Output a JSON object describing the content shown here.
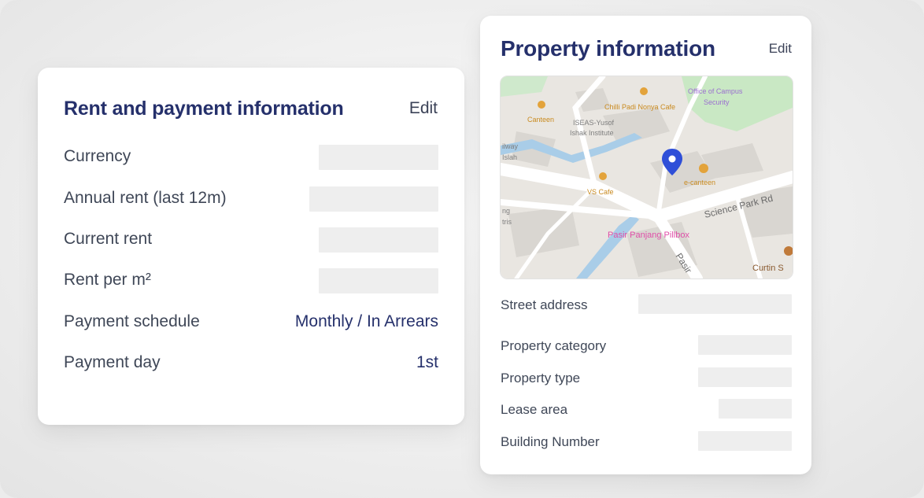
{
  "rent_card": {
    "title": "Rent and payment information",
    "edit_label": "Edit",
    "rows": [
      {
        "label": "Currency",
        "value": null
      },
      {
        "label": "Annual rent (last 12m)",
        "value": null
      },
      {
        "label": "Current rent",
        "value": null
      },
      {
        "label": "Rent per m²",
        "value": null
      },
      {
        "label": "Payment schedule",
        "value": "Monthly / In Arrears"
      },
      {
        "label": "Payment day",
        "value": "1st"
      }
    ]
  },
  "property_card": {
    "title": "Property information",
    "edit_label": "Edit",
    "map": {
      "labels": {
        "campus_security": "Office of Campus",
        "campus_security_2": "Security",
        "chilli_padi": "Chilli Padi Nonya Cafe",
        "iseas": "ISEAS-Yusof",
        "iseas_2": "Ishak Institute",
        "canteen": "Canteen",
        "vs_cafe": "VS Cafe",
        "e_canteen": "e-canteen",
        "science_park": "Science Park Rd",
        "pillbox": "Pasir Panjang Pillbox",
        "pasir": "Pasir",
        "curtin": "Curtin S",
        "railway": "ilway",
        "islah": "Islah",
        "ng": "ng",
        "tris": "tris"
      },
      "pin_icon": "map-pin-icon",
      "pin_color": "#2f4fd8"
    },
    "rows": [
      {
        "label": "Street address",
        "value": null
      },
      {
        "label": "Property category",
        "value": null
      },
      {
        "label": "Property type",
        "value": null
      },
      {
        "label": "Lease area",
        "value": null
      },
      {
        "label": "Building Number",
        "value": null
      }
    ]
  },
  "colors": {
    "title": "#25306b",
    "label": "#3f4757",
    "placeholder": "#eeeeee",
    "card": "#ffffff"
  }
}
